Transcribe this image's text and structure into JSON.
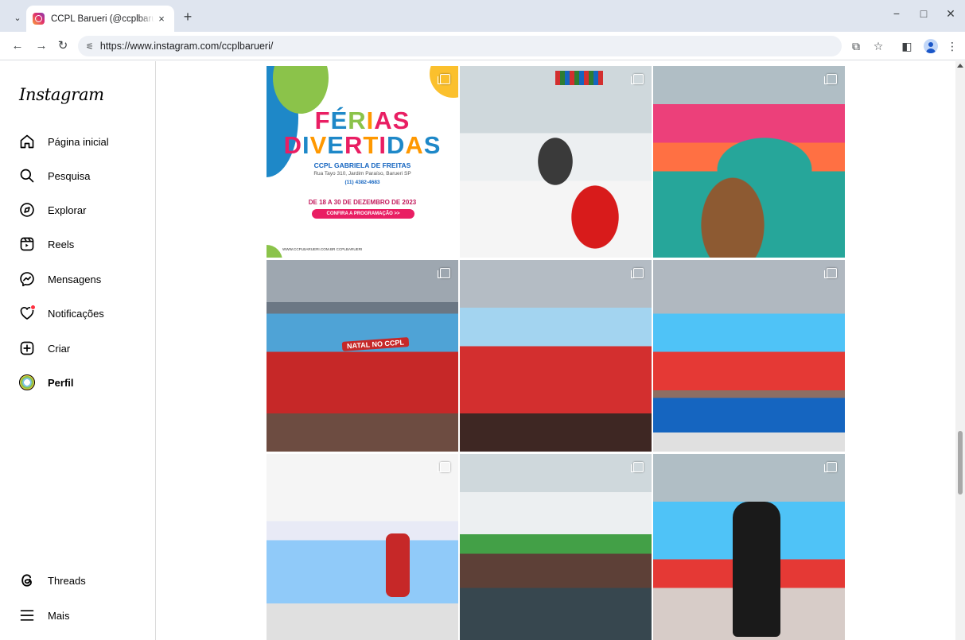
{
  "browser": {
    "tab_title": "CCPL Barueri (@ccplbarueri) • Fotos e vídeos do Instagram",
    "tab_close": "×",
    "new_tab": "+",
    "url": "https://www.instagram.com/ccplbarueri/",
    "window_controls": {
      "minimize": "−",
      "maximize": "□",
      "close": "✕"
    }
  },
  "sidebar": {
    "logo": "Instagram",
    "items": [
      {
        "label": "Página inicial",
        "icon": "home-icon"
      },
      {
        "label": "Pesquisa",
        "icon": "search-icon"
      },
      {
        "label": "Explorar",
        "icon": "compass-icon"
      },
      {
        "label": "Reels",
        "icon": "reels-icon"
      },
      {
        "label": "Mensagens",
        "icon": "messenger-icon"
      },
      {
        "label": "Notificações",
        "icon": "heart-icon"
      },
      {
        "label": "Criar",
        "icon": "plus-square-icon"
      },
      {
        "label": "Perfil",
        "icon": "avatar"
      }
    ],
    "bottom_items": [
      {
        "label": "Threads",
        "icon": "threads-icon"
      },
      {
        "label": "Mais",
        "icon": "menu-icon"
      }
    ]
  },
  "flyer": {
    "title_line1": "FÉRIAS",
    "title_line2": "DIVERTIDAS",
    "school": "CCPL GABRIELA DE FREITAS",
    "address": "Rua Tayo 310, Jardim Paraíso, Barueri SP",
    "phone": "(11) 4382-4683",
    "dates": "DE 18 A 30 DE DEZEMBRO DE 2023",
    "cta": "CONFIRA A PROGRAMAÇÃO >>",
    "footer": "WWW.CCPLBARUERI.COM.BR   CCPLBARUERI"
  },
  "posts": {
    "banner_text": "NATAL NO CCPL"
  },
  "colors": {
    "accent_red": "#ff3040",
    "sidebar_border": "#dbdbdb"
  }
}
